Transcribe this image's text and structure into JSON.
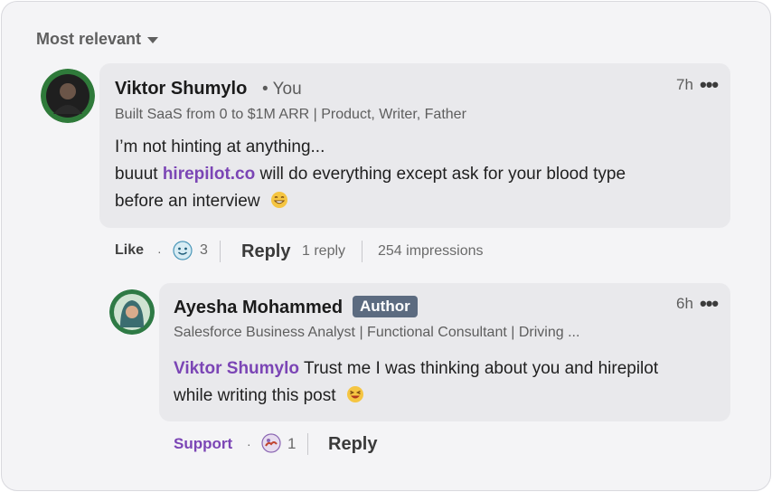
{
  "sort": {
    "label": "Most relevant"
  },
  "comment": {
    "author": "Viktor Shumylo",
    "you_label": "• You",
    "headline": "Built SaaS from 0 to $1M ARR | Product, Writer, Father",
    "time": "7h",
    "more": "•••",
    "line1": "I’m not hinting at anything...",
    "line2_pre": "buuut ",
    "line2_link": "hirepilot.co",
    "line2_post": " will do everything except ask for your blood type",
    "line3": "before an interview",
    "actions": {
      "like": "Like",
      "dot": "·",
      "reaction_count": "3",
      "reply": "Reply",
      "reply_count": "1 reply",
      "impressions": "254 impressions"
    }
  },
  "reply": {
    "author": "Ayesha Mohammed",
    "badge": "Author",
    "headline": "Salesforce Business Analyst | Functional Consultant | Driving ...",
    "time": "6h",
    "more": "•••",
    "mention": "Viktor Shumylo",
    "line1_rest": " Trust me I was thinking about you and hirepilot",
    "line2": "while writing this post",
    "actions": {
      "support": "Support",
      "dot": "·",
      "reaction_count": "1",
      "reply": "Reply"
    }
  },
  "colors": {
    "accent_purple": "#7b45b5",
    "badge_bg": "#5c6b80",
    "bubble_bg": "#e9e9ec"
  },
  "icons": [
    "caret-down-icon",
    "more-icon",
    "grin-emoji-icon",
    "laugh-emoji-icon",
    "reaction-icon",
    "support-reaction-icon"
  ]
}
